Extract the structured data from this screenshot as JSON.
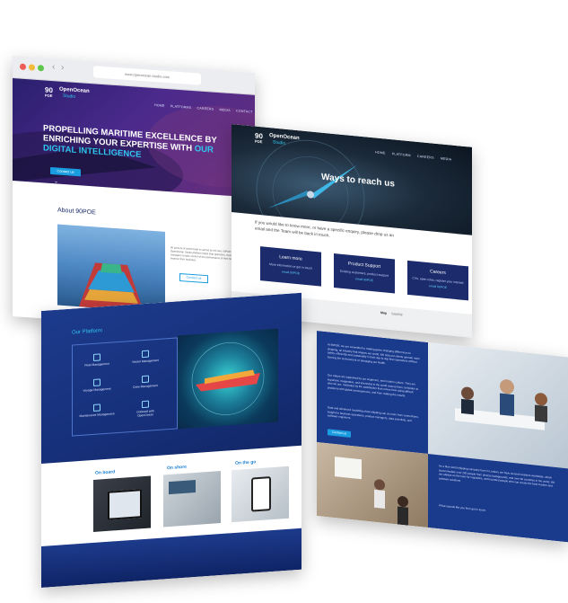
{
  "home": {
    "browser": {
      "url": "www.openocean-studio.com"
    },
    "logo": {
      "mark": "90",
      "mark_sub": "POE",
      "name": "OpenOcean",
      "sub": "Studio"
    },
    "nav": [
      "HOME",
      "PLATFORMS",
      "CAREERS",
      "MEDIA",
      "CONTACT"
    ],
    "hero_title_main": "PROPELLING MARITIME EXCELLENCE BY ENRICHING YOUR EXPERTISE WITH",
    "hero_title_accent": "OUR DIGITAL INTELLIGENCE",
    "hero_button": "Contact us",
    "about_title": "About 90POE",
    "about_text": "90 percent of world trade is carried by the sea. 90POE's OpenOcean Studio platform helps ship operators, owners and managers to take control of the performance of their fleet and to improve their business.",
    "about_button": "Contact us"
  },
  "contact": {
    "logo": {
      "mark": "90",
      "mark_sub": "POE",
      "name": "OpenOcean",
      "sub": "Studio"
    },
    "nav": [
      "HOME",
      "PLATFORM",
      "CAREERS",
      "MEDIA"
    ],
    "hero_title": "Ways to reach us",
    "intro": "If you would like to know more, or have a specific enquiry, please drop us an email and the Team will be back in touch.",
    "cards": [
      {
        "title": "Learn more",
        "sub": "More information or get in touch",
        "link": "email 90POE"
      },
      {
        "title": "Product Support",
        "sub": "Existing customers, product support",
        "link": "email 90POE"
      },
      {
        "title": "Careers",
        "sub": "CVs, open roles, register your interest",
        "link": "email 90POE"
      }
    ],
    "map_tabs": [
      "Map",
      "Satellite"
    ]
  },
  "platform": {
    "title": "Our Platform",
    "features": [
      "Fleet Management",
      "Vessel Management",
      "Voyage Management",
      "Crew Management",
      "Maintenance Management",
      "Onboard with OpenOcean"
    ],
    "tabs": [
      "On board",
      "On shore",
      "On the go"
    ]
  },
  "about_content": {
    "text1": "At 90POE, we are committed to making game changing differences to shipping, an industry that shapes our world. We help our clients operate more safely, efficiently and sustainably in their day to day fleet operations without burning the environment or damaging our health.",
    "text2": "Our values are supported by our engineers, and modern culture. They are important, imaginative, and interested in the world around them, beholden to who we are, motivated by the satisfaction that comes from doing difficult problems with global consequences, and from making the results.",
    "text3": "Data and advanced modelling show shipping can do more from connections, insight for business operations, product managers, data scientists, and software engineers.",
    "button": "Contact us",
    "text4": "As a blue world shipping company born in London, we have several locations worldwide, which accommodate over 200 people from diverse backgrounds, and over 50 countries in the world. We are always on the hunt for inquisitive, well-rounded people who can create the best modern and software solutions.",
    "text5": "If that sounds like you then get in touch."
  },
  "colors": {
    "navy": "#1b2b6b",
    "accent_cyan": "#2fc5f0",
    "button_blue": "#1a9de0",
    "hero_purple": "#4b2a8c",
    "platform_blue": "#1d3b8c"
  }
}
